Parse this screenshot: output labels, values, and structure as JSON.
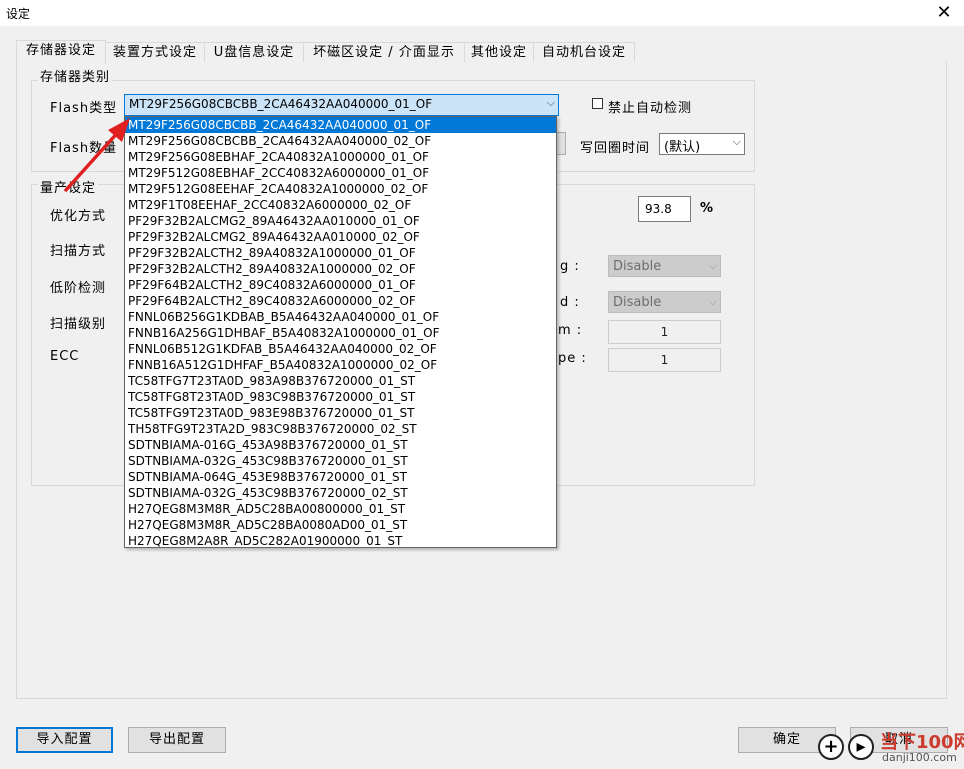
{
  "window": {
    "title": "设定",
    "close_glyph": "✕"
  },
  "tabs": [
    {
      "label": "存储器设定",
      "active": true
    },
    {
      "label": "装置方式设定"
    },
    {
      "label": "U盘信息设定"
    },
    {
      "label": "坏磁区设定 / 介面显示"
    },
    {
      "label": "其他设定"
    },
    {
      "label": "自动机台设定"
    }
  ],
  "storage_type": {
    "group_title": "存储器类别",
    "flash_type_label": "Flash类型",
    "flash_type_value": "MT29F256G08CBCBB_2CA46432AA040000_01_OF",
    "flash_count_label": "Flash数量",
    "disable_auto_detect_label": "禁止自动检测",
    "write_back_time_label": "写回圈时间",
    "write_back_time_value": "(默认)"
  },
  "flash_options": [
    "MT29F256G08CBCBB_2CA46432AA040000_01_OF",
    "MT29F256G08CBCBB_2CA46432AA040000_02_OF",
    "MT29F256G08EBHAF_2CA40832A1000000_01_OF",
    "MT29F512G08EBHAF_2CC40832A6000000_01_OF",
    "MT29F512G08EEHAF_2CA40832A1000000_02_OF",
    "MT29F1T08EEHAF_2CC40832A6000000_02_OF",
    "PF29F32B2ALCMG2_89A46432AA010000_01_OF",
    "PF29F32B2ALCMG2_89A46432AA010000_02_OF",
    "PF29F32B2ALCTH2_89A40832A1000000_01_OF",
    "PF29F32B2ALCTH2_89A40832A1000000_02_OF",
    "PF29F64B2ALCTH2_89C40832A6000000_01_OF",
    "PF29F64B2ALCTH2_89C40832A6000000_02_OF",
    "FNNL06B256G1KDBAB_B5A46432AA040000_01_OF",
    "FNNB16A256G1DHBAF_B5A40832A1000000_01_OF",
    "FNNL06B512G1KDFAB_B5A46432AA040000_02_OF",
    "FNNB16A512G1DHFAF_B5A40832A1000000_02_OF",
    "TC58TFG7T23TA0D_983A98B376720000_01_ST",
    "TC58TFG8T23TA0D_983C98B376720000_01_ST",
    "TC58TFG9T23TA0D_983E98B376720000_01_ST",
    "TH58TFG9T23TA2D_983C98B376720000_02_ST",
    "SDTNBIAMA-016G_453A98B376720000_01_ST",
    "SDTNBIAMA-032G_453C98B376720000_01_ST",
    "SDTNBIAMA-064G_453E98B376720000_01_ST",
    "SDTNBIAMA-032G_453C98B376720000_02_ST",
    "H27QEG8M3M8R_AD5C28BA00800000_01_ST",
    "H27QEG8M3M8R_AD5C28BA0080AD00_01_ST",
    "H27QEG8M2A8R_AD5C282A01900000_01_ST"
  ],
  "mass_production": {
    "group_title": "量产设定",
    "optimize_label": "优化方式",
    "scan_mode_label": "扫描方式",
    "low_level_label": "低阶检测",
    "scan_level_label": "扫描级别",
    "ecc_label": "ECC",
    "percent_value": "93.8",
    "percent_sign": "%",
    "partial_label_1": "g :",
    "partial_label_2": "d :",
    "partial_label_3": "m :",
    "partial_label_4": "pe :",
    "combo1_value": "Disable",
    "combo2_value": "Disable",
    "edit3_value": "1",
    "edit4_value": "1"
  },
  "buttons": {
    "import": "导入配置",
    "export": "导出配置",
    "ok": "确定",
    "cancel": "取消"
  },
  "watermark": {
    "brand": "当下100网",
    "url": "danji100.com"
  },
  "colors": {
    "accent": "#0078d7",
    "arrow": "#e02020"
  }
}
